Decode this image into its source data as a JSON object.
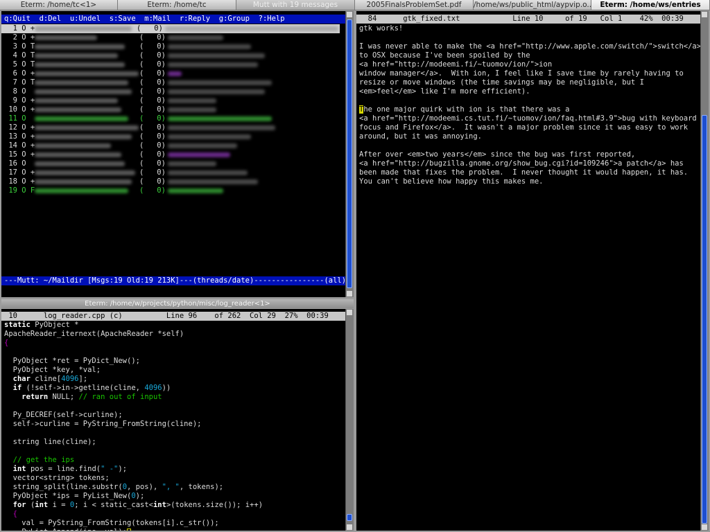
{
  "tabs": [
    {
      "label": "Eterm: /home/tc<1>"
    },
    {
      "label": "Eterm: /home/tc"
    },
    {
      "label": "Mutt with 19 messages"
    },
    {
      "label": "2005FinalsProblemSet.pdf"
    },
    {
      "label": "/home/ws/public_html/aypvip.o..."
    },
    {
      "label": "Eterm: /home/ws/entries"
    }
  ],
  "mutt": {
    "help_line": "q:Quit  d:Del  u:Undel  s:Save  m:Mail  r:Reply  g:Group  ?:Help",
    "status_line": "---Mutt: ~/Maildir [Msgs:19 Old:19 213K]---(threads/date)----------------(all)---",
    "messages": [
      {
        "num": "1",
        "flag": "O +",
        "size": "(   0)"
      },
      {
        "num": "2",
        "flag": "O +",
        "size": "(   0)"
      },
      {
        "num": "3",
        "flag": "O T",
        "size": "(   0)"
      },
      {
        "num": "4",
        "flag": "O T",
        "size": "(   0)"
      },
      {
        "num": "5",
        "flag": "O T",
        "size": "(   0)"
      },
      {
        "num": "6",
        "flag": "O +",
        "size": "(   0)"
      },
      {
        "num": "7",
        "flag": "O T",
        "size": "(   0)"
      },
      {
        "num": "8",
        "flag": "O",
        "size": "(   0)"
      },
      {
        "num": "9",
        "flag": "O +",
        "size": "(   0)"
      },
      {
        "num": "10",
        "flag": "O +",
        "size": "(   0)"
      },
      {
        "num": "11",
        "flag": "O",
        "size": "(   0)"
      },
      {
        "num": "12",
        "flag": "O +",
        "size": "(   0)"
      },
      {
        "num": "13",
        "flag": "O +",
        "size": "(   0)"
      },
      {
        "num": "14",
        "flag": "O +",
        "size": "(   0)"
      },
      {
        "num": "15",
        "flag": "O +",
        "size": "(   0)"
      },
      {
        "num": "16",
        "flag": "O",
        "size": "(   0)"
      },
      {
        "num": "17",
        "flag": "O +",
        "size": "(   0)"
      },
      {
        "num": "18",
        "flag": "O +",
        "size": "(   0)"
      },
      {
        "num": "19",
        "flag": "O F",
        "size": "(   0)"
      }
    ]
  },
  "editor_left": {
    "title": "Eterm: /home/w/projects/python/misc/log_reader<1>",
    "status": " 10      log_reader.cpp (c)          Line 96    of 262  Col 29  27%  00:39"
  },
  "editor_right": {
    "status": "  84      gtk_fixed.txt            Line 10     of 19   Col 1    42%  00:39",
    "text_lines": [
      "gtk works!",
      "",
      "I was never able to make the <a href=\"http://www.apple.com/switch/\">switch</a>",
      "to OSX because I've been spoiled by the",
      "<a href=\"http://modeemi.fi/~tuomov/ion/\">ion",
      "window manager</a>.  With ion, I feel like I save time by rarely having to",
      "resize or move windows (the time savings may be negligible, but I",
      "<em>feel</em> like I'm more efficient).",
      "",
      "The one major quirk with ion is that there was a",
      "<a href=\"http://modeemi.cs.tut.fi/~tuomov/ion/faq.html#3.9\">bug with keyboard",
      "focus and Firefox</a>.  It wasn't a major problem since it was easy to work",
      "around, but it was annoying.",
      "",
      "After over <em>two years</em> since the bug was first reported,",
      "<a href=\"http://bugzilla.gnome.org/show_bug.cgi?id=109246\">a patch</a> has",
      "been made that fixes the problem.  I never thought it would happen, it has.",
      "You can't believe how happy this makes me."
    ]
  },
  "colors": {
    "mutt_bar": "#0010b8",
    "code_comment": "#19c400",
    "code_number": "#19a8d8",
    "code_brace": "#b500b5",
    "cursor": "#d8d800"
  }
}
